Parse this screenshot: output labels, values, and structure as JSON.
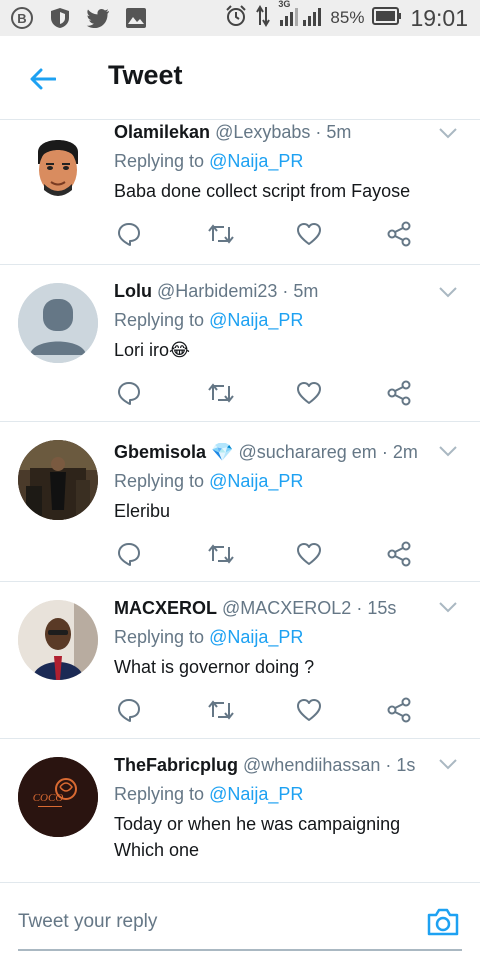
{
  "status_bar": {
    "battery": "85%",
    "time": "19:01",
    "network": "3G",
    "icons": [
      "bbm-icon",
      "shield-icon",
      "twitter-bird-icon",
      "gallery-icon",
      "alarm-icon",
      "data-arrows-icon",
      "signal-icon",
      "battery-icon"
    ]
  },
  "header": {
    "title": "Tweet",
    "back_icon": "back-arrow-icon"
  },
  "tweets": [
    {
      "name": "Olamilekan",
      "handle": "@Lexybabs",
      "time": "· 5m",
      "replying": "Replying to",
      "reply_to": "@Naija_PR",
      "text": "Baba done collect script from Fayose",
      "avatar": "cartoon-face"
    },
    {
      "name": "Lolu",
      "handle": "@Harbidemi23",
      "time": "· 5m",
      "replying": "Replying to",
      "reply_to": "@Naija_PR",
      "text": "Lori iro😂",
      "avatar": "default-user"
    },
    {
      "name": "Gbemisola 💎",
      "handle": "@sucharareg em",
      "time": "· 2m",
      "replying": "Replying to",
      "reply_to": "@Naija_PR",
      "text": "Eleribu",
      "avatar": "photo-person"
    },
    {
      "name": "MACXEROL",
      "handle": "@MACXEROL2",
      "time": "· 15s",
      "replying": "Replying to",
      "reply_to": "@Naija_PR",
      "text": "What is governor doing ?",
      "avatar": "photo-man"
    },
    {
      "name": "TheFabricplug",
      "handle": "@whendiihassan",
      "time": "· 1s",
      "replying": "Replying to",
      "reply_to": "@Naija_PR",
      "text": "Today or when he  was campaigning",
      "text2": "Which one",
      "avatar": "coco-logo",
      "logo_text": "COCO"
    }
  ],
  "reply_bar": {
    "placeholder": "Tweet your reply"
  },
  "colors": {
    "accent": "#1da1f2",
    "secondary": "#657786",
    "divider": "#e1e8ed"
  }
}
